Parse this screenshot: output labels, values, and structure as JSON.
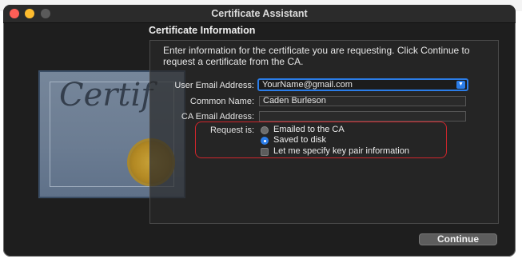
{
  "window": {
    "title": "Certificate Assistant"
  },
  "section_title": "Certificate Information",
  "instructions": "Enter information for the certificate you are requesting. Click Continue to request a certificate from the CA.",
  "fields": {
    "user_email": {
      "label": "User Email Address:",
      "value": "YourName@gmail.com"
    },
    "common_name": {
      "label": "Common Name:",
      "value": "Caden Burleson"
    },
    "ca_email": {
      "label": "CA Email Address:",
      "value": ""
    }
  },
  "request": {
    "label": "Request is:",
    "options": [
      {
        "label": "Emailed to the CA",
        "selected": false
      },
      {
        "label": "Saved to disk",
        "selected": true
      }
    ],
    "checkbox": {
      "label": "Let me specify key pair information",
      "checked": false
    }
  },
  "buttons": {
    "continue": "Continue"
  },
  "icons": {
    "combo_arrow": "chevron-down-icon",
    "certificate_art": "certificate-icon"
  },
  "colors": {
    "accent": "#2b7de9",
    "highlight": "#d0262c",
    "window_bg": "#1e1e1e"
  }
}
